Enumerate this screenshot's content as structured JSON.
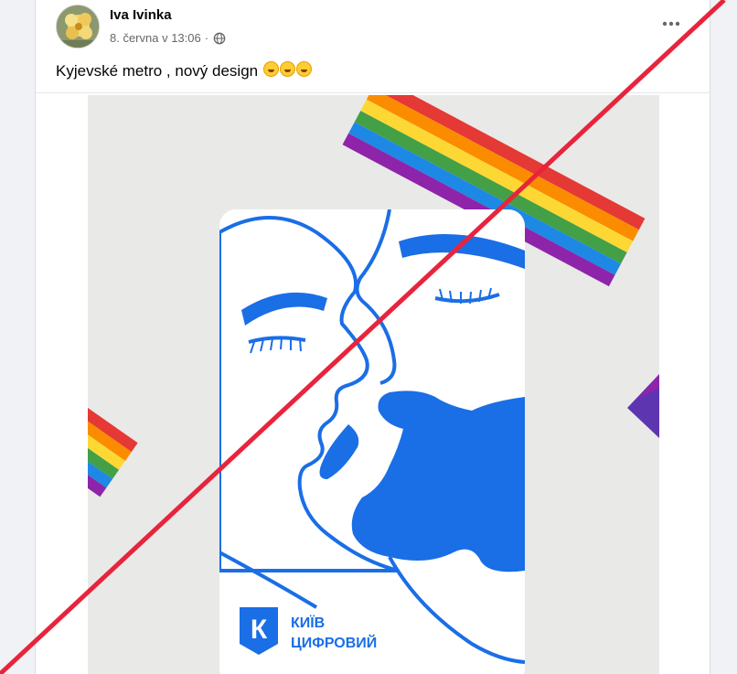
{
  "post": {
    "author": "Iva Ivinka",
    "timestamp": "8. června v 13:06",
    "separator": "·",
    "visibility_icon": "globe-icon",
    "more_icon": "more-horizontal-icon",
    "text": "Kyjevské metro , nový design",
    "emojis": [
      "rolling-on-floor-laughing",
      "rolling-on-floor-laughing",
      "rolling-on-floor-laughing"
    ]
  },
  "card": {
    "brand_letter": "К",
    "brand_line1": "КИЇВ",
    "brand_line2": "ЦИФРОВИЙ",
    "brand_color": "#1a6ee6"
  },
  "overlay": {
    "type": "red-diagonal-strike",
    "color": "#e8243c"
  }
}
